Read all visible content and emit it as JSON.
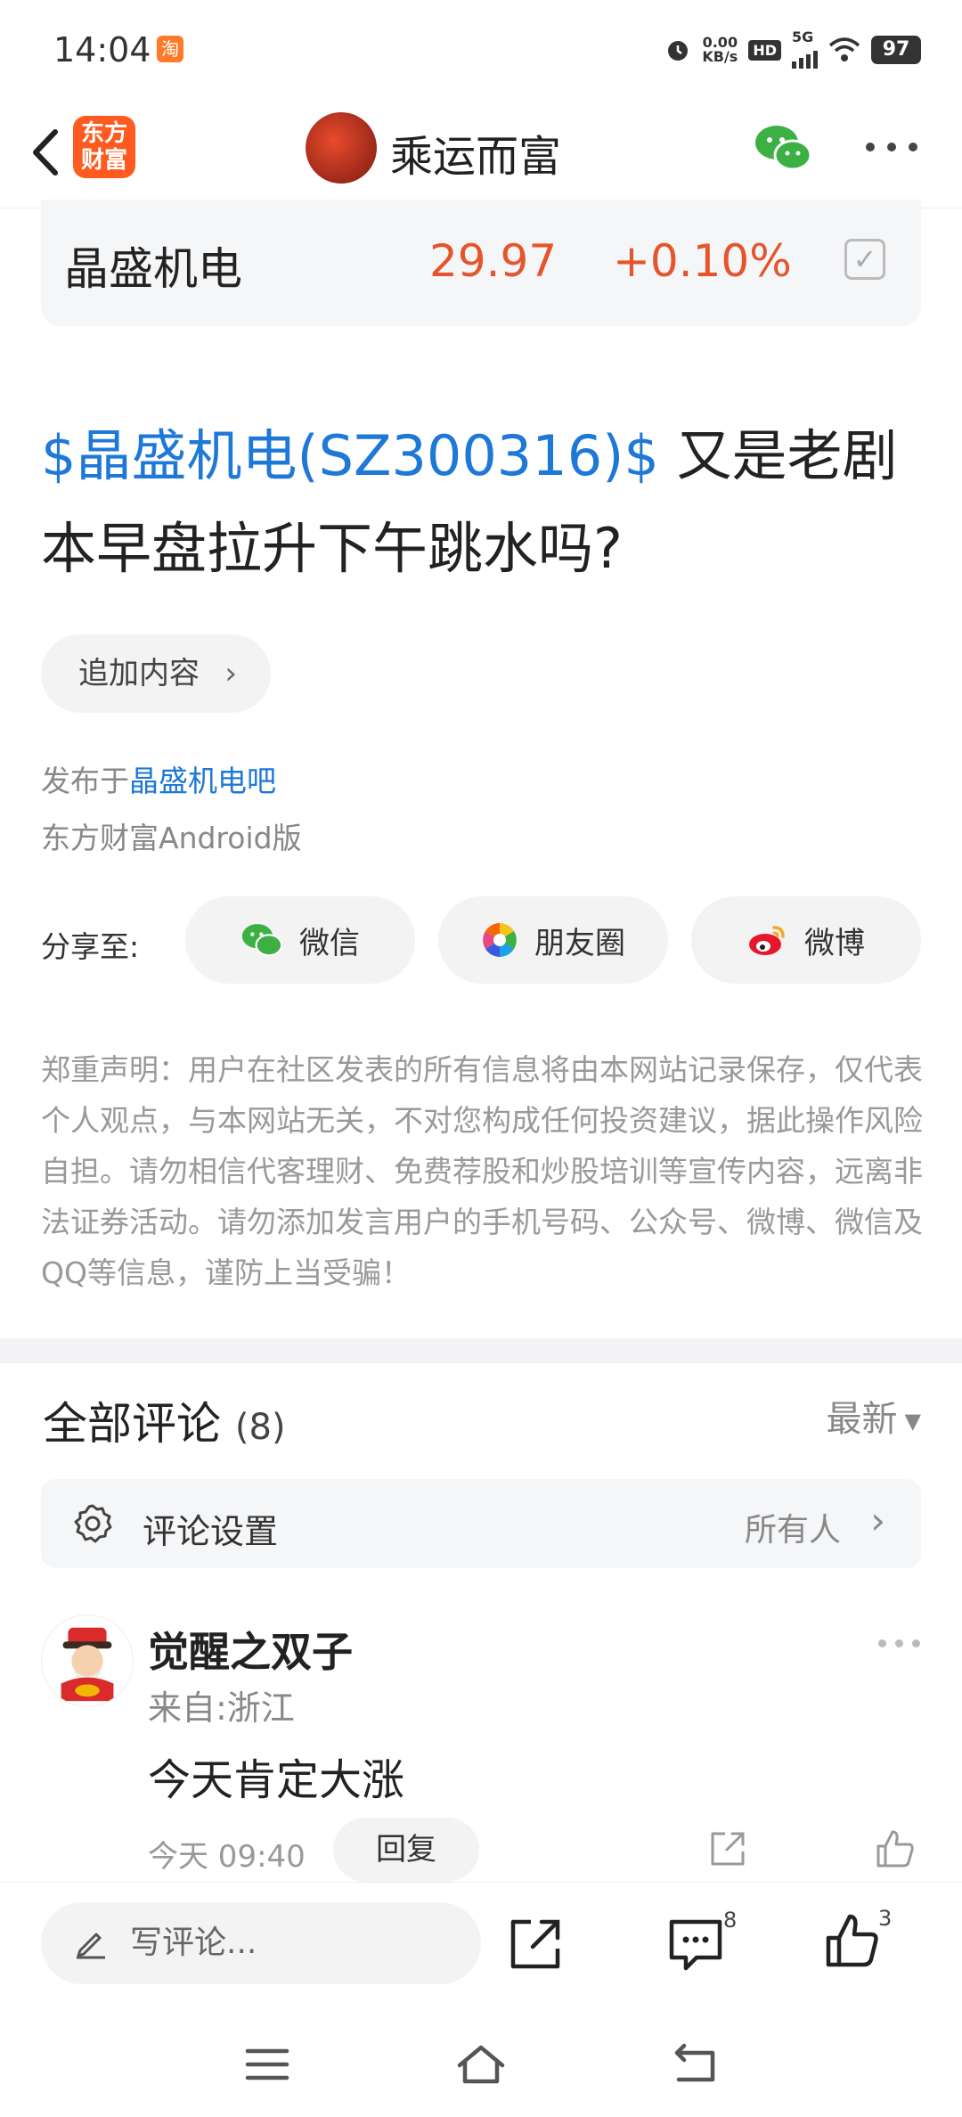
{
  "status_bar": {
    "time": "14:04",
    "taobao_icon": "淘",
    "net_speed_value": "0.00",
    "net_speed_unit": "KB/s",
    "hd_label": "HD",
    "network": "5G",
    "battery": "97"
  },
  "nav": {
    "app_logo_line1": "东方",
    "app_logo_line2": "财富",
    "title": "乘运而富"
  },
  "stock": {
    "name": "晶盛机电",
    "price": "29.97",
    "change": "+0.10%"
  },
  "post": {
    "tag": "$晶盛机电(SZ300316)$",
    "title_rest": " 又是老剧本早盘拉升下午跳水吗?",
    "add_content": "追加内容",
    "published_prefix": "发布于",
    "published_bar": "晶盛机电吧",
    "device": "东方财富Android版"
  },
  "share": {
    "label": "分享至:",
    "wechat": "微信",
    "moments": "朋友圈",
    "weibo": "微博"
  },
  "disclaimer": "郑重声明：用户在社区发表的所有信息将由本网站记录保存，仅代表个人观点，与本网站无关，不对您构成任何投资建议，据此操作风险自担。请勿相信代客理财、免费荐股和炒股培训等宣传内容，远离非法证券活动。请勿添加发言用户的手机号码、公众号、微博、微信及QQ等信息，谨防上当受骗！",
  "comments": {
    "title": "全部评论",
    "count": "(8)",
    "sort": "最新",
    "settings_label": "评论设置",
    "settings_value": "所有人",
    "items": [
      {
        "user": "觉醒之双子",
        "from": "来自:浙江",
        "text": "今天肯定大涨",
        "time": "今天 09:40",
        "reply": "回复"
      }
    ]
  },
  "action_bar": {
    "write_placeholder": "写评论...",
    "comment_count": "8",
    "like_count": "3"
  },
  "colors": {
    "accent_blue": "#1e78d8",
    "stock_red": "#e6542c",
    "brand_orange": "#ff5a1f"
  }
}
